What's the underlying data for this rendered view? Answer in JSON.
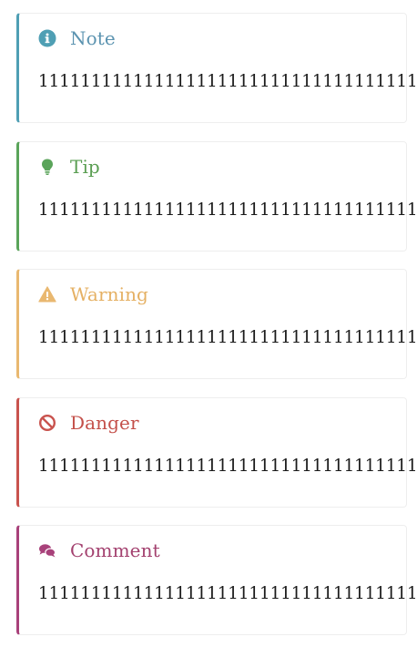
{
  "callouts": [
    {
      "kind": "note",
      "title": "Note",
      "icon": "info-circle-icon",
      "color": "#4f9fb4",
      "body": "1111111111111111111111111111111111111"
    },
    {
      "kind": "tip",
      "title": "Tip",
      "icon": "lightbulb-icon",
      "color": "#5aa45a",
      "body": "1111111111111111111111111111111111111"
    },
    {
      "kind": "warning",
      "title": "Warning",
      "icon": "warning-triangle-icon",
      "color": "#e9b870",
      "body": "1111111111111111111111111111111111111"
    },
    {
      "kind": "danger",
      "title": "Danger",
      "icon": "ban-icon",
      "color": "#c9534e",
      "body": "1111111111111111111111111111111111111"
    },
    {
      "kind": "comment",
      "title": "Comment",
      "icon": "comments-icon",
      "color": "#a8417a",
      "body": "1111111111111111111111111111111111111"
    }
  ]
}
